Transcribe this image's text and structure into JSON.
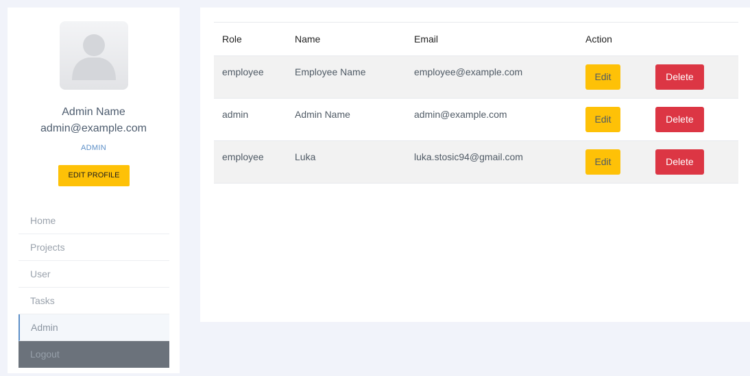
{
  "sidebar": {
    "profile": {
      "name": "Admin Name",
      "email": "admin@example.com",
      "role": "ADMIN",
      "edit_button": "EDIT PROFILE",
      "avatar_icon": "user-placeholder-icon"
    },
    "nav": [
      {
        "label": "Home"
      },
      {
        "label": "Projects"
      },
      {
        "label": "User"
      },
      {
        "label": "Tasks"
      },
      {
        "label": "Admin",
        "active": true
      },
      {
        "label": "Logout"
      }
    ]
  },
  "table": {
    "headers": {
      "role": "Role",
      "name": "Name",
      "email": "Email",
      "action": "Action"
    },
    "rows": [
      {
        "role": "employee",
        "name": "Employee Name",
        "email": "employee@example.com",
        "edit": "Edit",
        "delete": "Delete"
      },
      {
        "role": "admin",
        "name": "Admin Name",
        "email": "admin@example.com",
        "edit": "Edit",
        "delete": "Delete"
      },
      {
        "role": "employee",
        "name": "Luka",
        "email": "luka.stosic94@gmail.com",
        "edit": "Edit",
        "delete": "Delete"
      }
    ]
  },
  "colors": {
    "background": "#f1f3fa",
    "edit_button": "#fec107",
    "delete_button": "#dc3644",
    "accent": "#5b8ec7",
    "logout_background": "#6b727b"
  }
}
